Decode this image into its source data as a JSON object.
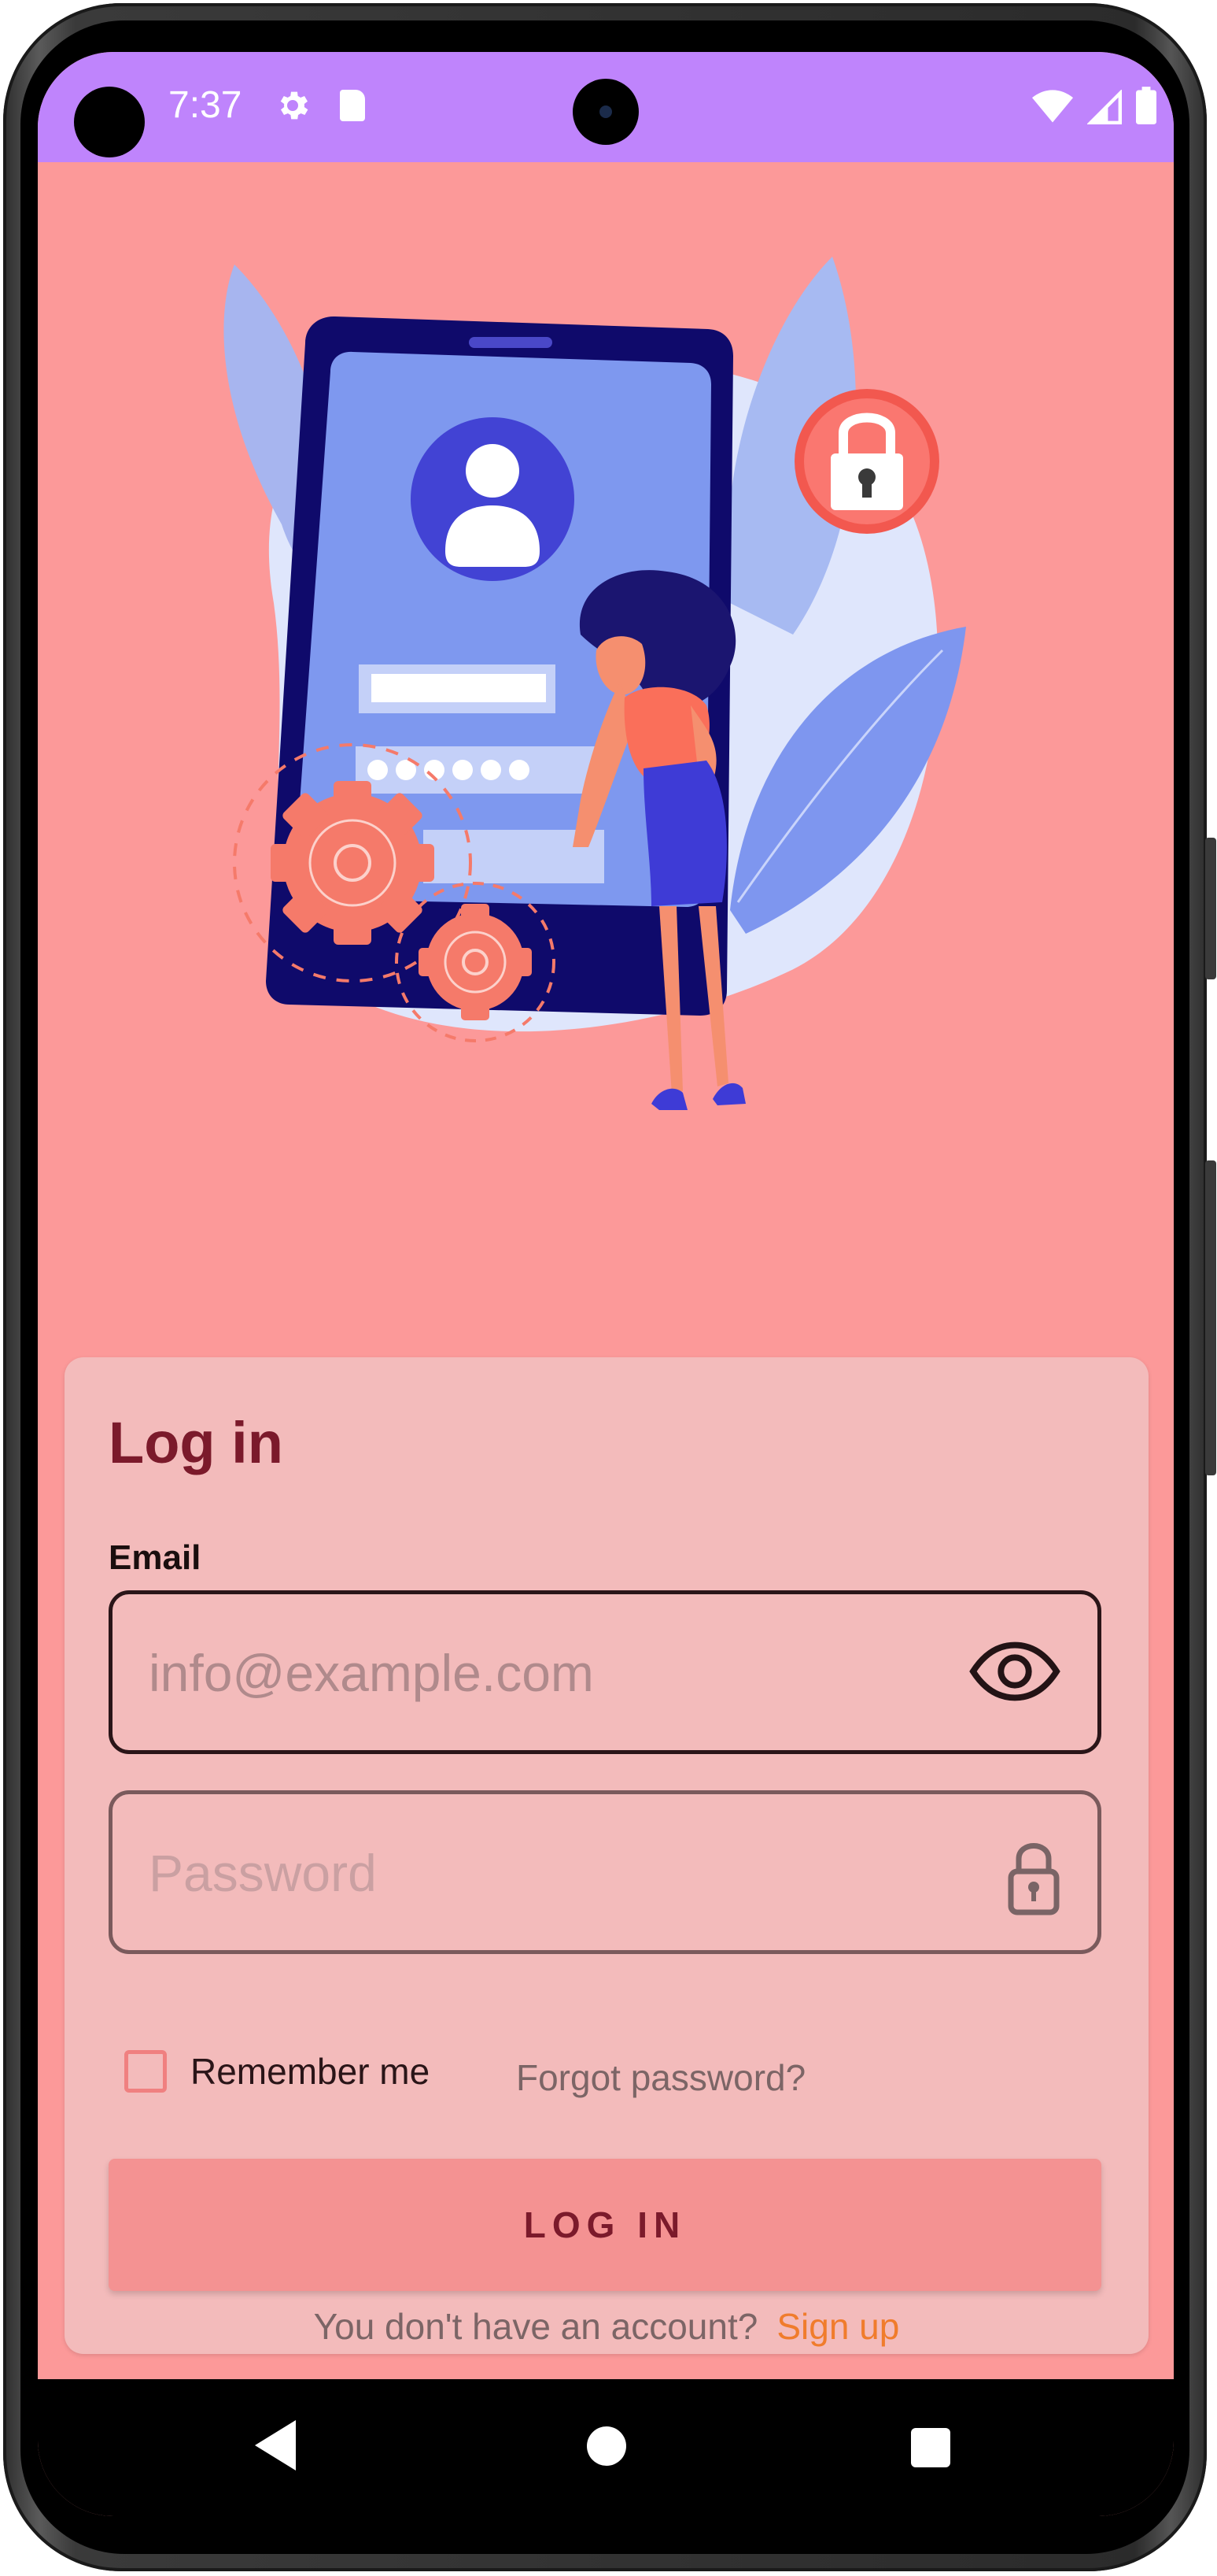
{
  "status_bar": {
    "time": "7:37",
    "icons": [
      "settings-icon",
      "sd-card-icon",
      "wifi-icon",
      "signal-icon",
      "battery-icon"
    ],
    "background": "#bf84fc"
  },
  "screen": {
    "background": "#fc9999"
  },
  "login": {
    "title": "Log in",
    "email_label": "Email",
    "email_placeholder": "info@example.com",
    "password_placeholder": "Password",
    "remember_label": "Remember me",
    "forgot_label": "Forgot password?",
    "login_button": "LOG IN",
    "signup_question": "You don't have an account?",
    "signup_link": "Sign up"
  },
  "colors": {
    "title": "#7b1a2b",
    "link": "#f07c2c",
    "button": "#f49292",
    "card": "#f3bbbb"
  },
  "nav_bar": {
    "icons": [
      "back-icon",
      "home-icon",
      "recents-icon"
    ]
  }
}
